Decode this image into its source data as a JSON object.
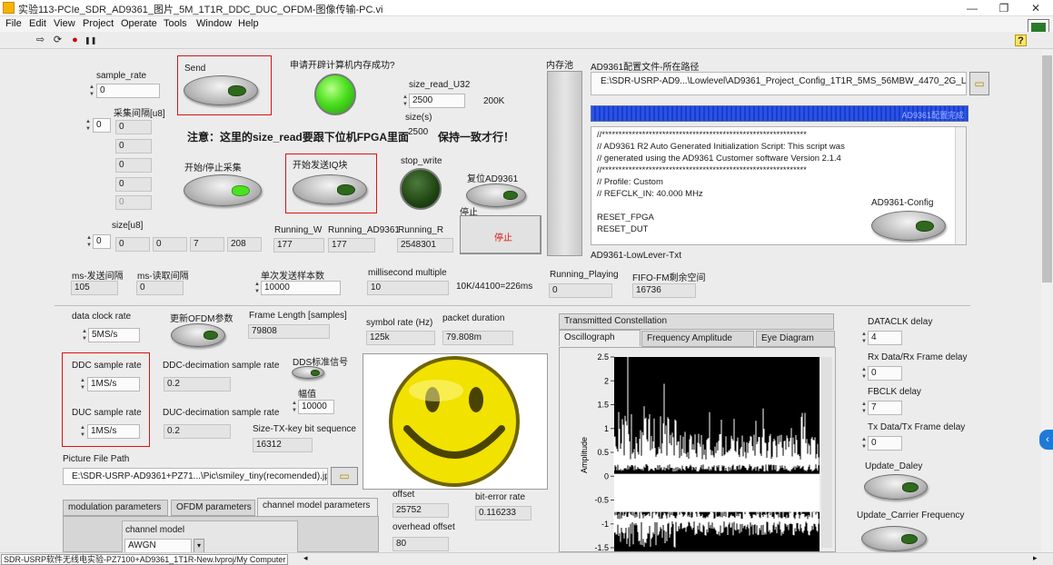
{
  "window": {
    "title": "实验113-PCIe_SDR_AD9361_图片_5M_1T1R_DDC_DUC_OFDM-图像传输-PC.vi",
    "minimize": "—",
    "restore": "❐",
    "close": "✕"
  },
  "menu": [
    "File",
    "Edit",
    "View",
    "Project",
    "Operate",
    "Tools",
    "Window",
    "Help"
  ],
  "toolbar": {
    "run": "⇨",
    "run_continuous": "⟳",
    "abort": "●",
    "pause": "❚❚",
    "help": "?"
  },
  "controls": {
    "sample_rate_label": "sample_rate",
    "sample_rate_value": "0",
    "send_label": "Send",
    "alloc_label": "申请开辟计算机内存成功?",
    "size_read_label": "size_read_U32",
    "size_read_value": "2500",
    "size_read_unit": "200K",
    "sizes_label": "size(s)",
    "sizes_value": "2500",
    "acq_interval_label": "采集间隔[u8]",
    "acq_index": "0",
    "acq_values": [
      "0",
      "0",
      "0",
      "0",
      "0"
    ],
    "note": "注意：这里的size_read要跟下位机FPGA里面",
    "note_tail": "保持一致才行！",
    "start_stop_label": "开始/停止采集",
    "start_send_label": "开始发送IQ块",
    "stop_write_label": "stop_write",
    "reset_label": "复位AD9361",
    "stop_label": "停止",
    "stop_button_label": "停止",
    "size_u8_label": "size[u8]",
    "size_u8_index": "0",
    "size_u8_values": [
      "0",
      "0",
      "7",
      "208"
    ],
    "running_w_label": "Running_W",
    "running_w_value": "177",
    "running_ad_label": "Running_AD9361",
    "running_ad_value": "177",
    "running_r_label": "Running_R",
    "running_r_value": "2548301",
    "ms_send_label": "ms-发送间隔",
    "ms_send_value": "105",
    "ms_read_label": "ms-读取间隔",
    "ms_read_value": "0",
    "single_send_label": "单次发送样本数",
    "single_send_value": "10000",
    "ms_multiple_label": "millisecond multiple",
    "ms_multiple_value": "10",
    "ms_formula": "10K/44100=226ms"
  },
  "memory_pool_label": "内存池",
  "ad9361": {
    "path_label": "AD9361配置文件-所在路径",
    "path_value": "E:\\SDR-USRP-AD9...\\Lowlevel\\AD9361_Project_Config_1T1R_5MS_56MBW_4470_2G_Lowlevel",
    "progress_label": "AD9361配置完成",
    "script_lines": [
      "//*************************************************************",
      "// AD9361 R2 Auto Generated Initialization Script:  This script was",
      "// generated using the AD9361 Customer software Version 2.1.4",
      "//*************************************************************",
      "// Profile: Custom",
      "// REFCLK_IN: 40.000 MHz",
      "",
      "RESET_FPGA",
      "RESET_DUT"
    ],
    "config_label": "AD9361-Config",
    "lowlever_label": "AD9361-LowLever-Txt",
    "running_playing_label": "Running_Playing",
    "running_playing_value": "0",
    "fifo_label": "FIFO-FM剩余空间",
    "fifo_value": "16736"
  },
  "ofdm": {
    "data_clock_label": "data clock rate",
    "data_clock_value": "5MS/s",
    "update_ofdm_label": "更新OFDM参数",
    "frame_length_label": "Frame Length [samples]",
    "frame_length_value": "79808",
    "symbol_rate_label": "symbol rate (Hz)",
    "symbol_rate_value": "125k",
    "packet_duration_label": "packet duration",
    "packet_duration_value": "79.808m",
    "ddc_label": "DDC sample rate",
    "ddc_value": "1MS/s",
    "ddc_dec_label": "DDC-decimation sample rate",
    "ddc_dec_value": "0.2",
    "dds_label": "DDS标准信号",
    "amplitude_label": "幅值",
    "amplitude_value": "10000",
    "duc_label": "DUC sample rate",
    "duc_value": "1MS/s",
    "duc_dec_label": "DUC-decimation sample rate",
    "duc_dec_value": "0.2",
    "tx_key_label": "Size-TX-key bit sequence",
    "tx_key_value": "16312",
    "picture_path_label": "Picture File Path",
    "picture_path_value": "E:\\SDR-USRP-AD9361+PZ71...\\Pic\\smiley_tiny(recomended).jpg",
    "offset_label": "offset",
    "offset_value": "25752",
    "ber_label": "bit-error rate",
    "ber_value": "0.116233",
    "overhead_label": "overhead offset",
    "overhead_value": "80"
  },
  "bottom_tabs": [
    "modulation parameters",
    "OFDM parameters",
    "channel model parameters"
  ],
  "channel_model_label": "channel model",
  "channel_model_value": "AWGN",
  "plot": {
    "tabs_top": [
      "Transmitted Constellation"
    ],
    "tabs": [
      "Oscillograph",
      "Frequency Amplitude",
      "Eye Diagram"
    ],
    "ylabel": "Amplitude",
    "yticks": [
      "2.5",
      "2",
      "1.5",
      "1",
      "0.5",
      "0",
      "-0.5",
      "-1",
      "-1.5"
    ],
    "ylim": [
      -1.5,
      2.5
    ]
  },
  "right": {
    "dataclk_label": "DATACLK delay",
    "dataclk_value": "4",
    "rxdata_label": "Rx Data/Rx Frame delay",
    "rxdata_value": "0",
    "fbclk_label": "FBCLK delay",
    "fbclk_value": "7",
    "txdata_label": "Tx Data/Tx Frame delay",
    "txdata_value": "0",
    "update_daley_label": "Update_Daley",
    "update_carrier_label": "Update_Carrier Frequency"
  },
  "status": "SDR-USRP软件无线电实验-PZ7100+AD9361_1T1R-New.lvproj/My Computer",
  "colors": {
    "accent_red": "#dd1111",
    "led_on": "#4ee022",
    "led_off": "#1f4412",
    "progress": "#1a3cc8"
  }
}
